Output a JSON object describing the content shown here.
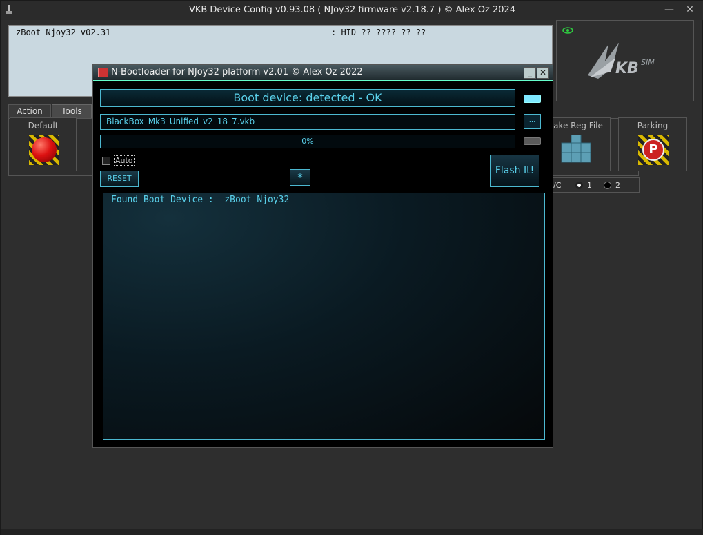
{
  "main_window": {
    "title": "VKB Device Config v0.93.08 ( NJoy32 firmware v2.18.7 ) © Alex Oz 2024",
    "minimize_label": "—",
    "close_label": "✕"
  },
  "info_panel": {
    "left_text": "zBoot Njoy32 v02.31",
    "right_text": ": HID ?? ???? ?? ??"
  },
  "logo": {
    "brand": "KB",
    "sub": "SIM",
    "icon": "eye-icon"
  },
  "tabs": [
    {
      "label": "Action"
    },
    {
      "label": "Tools"
    }
  ],
  "tiles": {
    "default_label": "Default",
    "makereg_label": "ake Reg File",
    "parking_label": "Parking"
  },
  "radio_row": {
    "prefix": "/C",
    "option1": "1",
    "option2": "2"
  },
  "dialog": {
    "title": "N-Bootloader for NJoy32 platform v2.01 © Alex Oz 2022",
    "status": "Boot device: detected - OK",
    "file": "_BlackBox_Mk3_Unified_v2_18_7.vkb",
    "browse_label": "...",
    "progress_text": "0%",
    "progress_value": 0,
    "auto_label": "Auto",
    "reset_label": "RESET",
    "star_label": "*",
    "flash_label": "Flash It!",
    "log_text": "Found Boot Device :  zBoot Njoy32"
  },
  "colors": {
    "accent_cyan": "#5ad0ea",
    "led_on": "#7fe8ff",
    "led_off": "#5a5a5a"
  }
}
